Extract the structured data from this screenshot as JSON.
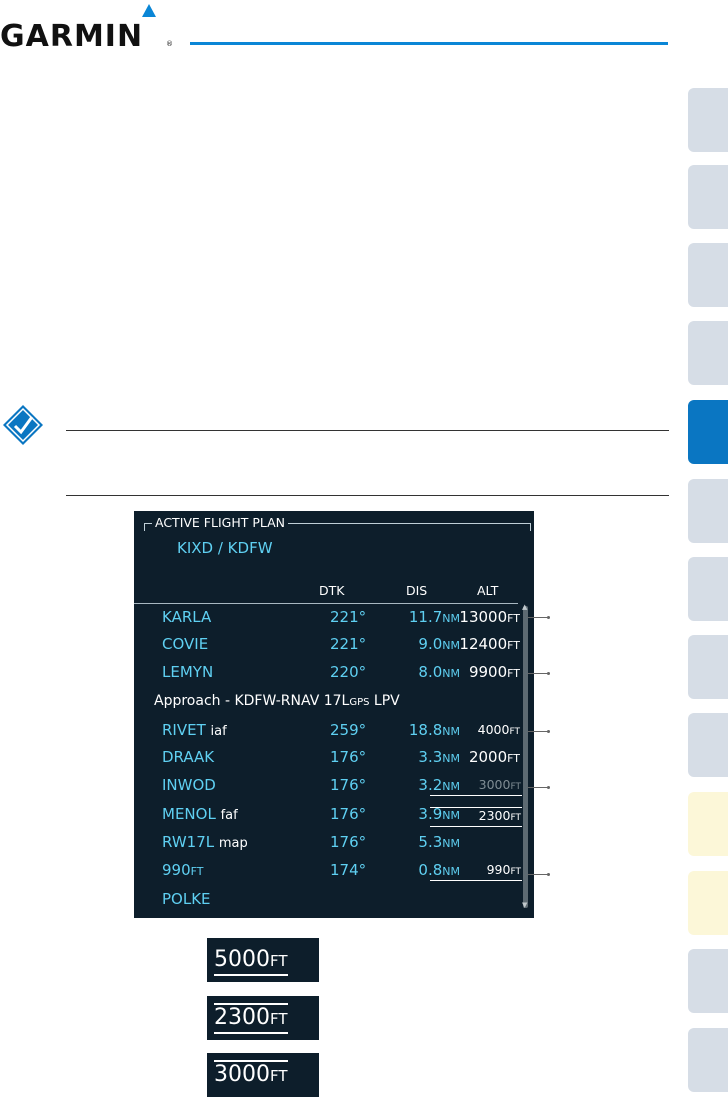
{
  "header": {
    "brand": "GARMIN",
    "reg_mark": "®"
  },
  "colors": {
    "accent": "#0a86d6",
    "screen_bg": "#0d1e2b",
    "waypoint_cyan": "#5fd0f2",
    "active_tab": "#0a76c2",
    "tab_gray": "#d6dde6",
    "tab_pale": "#fcf7d8"
  },
  "note_icon": "checkmark-note-icon",
  "flight_plan": {
    "title": "ACTIVE FLIGHT PLAN",
    "route": "KIXD / KDFW",
    "columns": {
      "dtk": "DTK",
      "dis": "DIS",
      "alt": "ALT"
    },
    "rows": [
      {
        "name": "KARLA",
        "leg": "",
        "dtk": "221°",
        "dis_val": "11.7",
        "dis_unit": "NM",
        "alt_val": "13000",
        "alt_unit": "FT"
      },
      {
        "name": "COVIE",
        "leg": "",
        "dtk": "221°",
        "dis_val": "9.0",
        "dis_unit": "NM",
        "alt_val": "12400",
        "alt_unit": "FT"
      },
      {
        "name": "LEMYN",
        "leg": "",
        "dtk": "220°",
        "dis_val": "8.0",
        "dis_unit": "NM",
        "alt_val": "9900",
        "alt_unit": "FT"
      },
      {
        "name": "RIVET",
        "leg": "iaf",
        "dtk": "259°",
        "dis_val": "18.8",
        "dis_unit": "NM",
        "alt_val": "4000",
        "alt_unit": "FT"
      },
      {
        "name": "DRAAK",
        "leg": "",
        "dtk": "176°",
        "dis_val": "3.3",
        "dis_unit": "NM",
        "alt_val": "2000",
        "alt_unit": "FT"
      },
      {
        "name": "INWOD",
        "leg": "",
        "dtk": "176°",
        "dis_val": "3.2",
        "dis_unit": "NM",
        "alt_val": "3000",
        "alt_unit": "FT"
      },
      {
        "name": "MENOL",
        "leg": "faf",
        "dtk": "176°",
        "dis_val": "3.9",
        "dis_unit": "NM",
        "alt_val": "2300",
        "alt_unit": "FT"
      },
      {
        "name": "RW17L",
        "leg": "map",
        "dtk": "176°",
        "dis_val": "5.3",
        "dis_unit": "NM",
        "alt_val": "",
        "alt_unit": ""
      },
      {
        "name": "990",
        "name_unit": "FT",
        "leg": "",
        "dtk": "174°",
        "dis_val": "0.8",
        "dis_unit": "NM",
        "alt_val": "990",
        "alt_unit": "FT"
      },
      {
        "name": "POLKE",
        "leg": "",
        "dtk": "",
        "dis_val": "",
        "dis_unit": "",
        "alt_val": "",
        "alt_unit": ""
      }
    ],
    "approach": {
      "prefix": "Approach - KDFW-RNAV 17L",
      "sub": "GPS",
      "suffix": " LPV"
    }
  },
  "swatches": [
    {
      "value": "5000",
      "unit": "FT"
    },
    {
      "value": "2300",
      "unit": "FT"
    },
    {
      "value": "3000",
      "unit": "FT"
    }
  ]
}
